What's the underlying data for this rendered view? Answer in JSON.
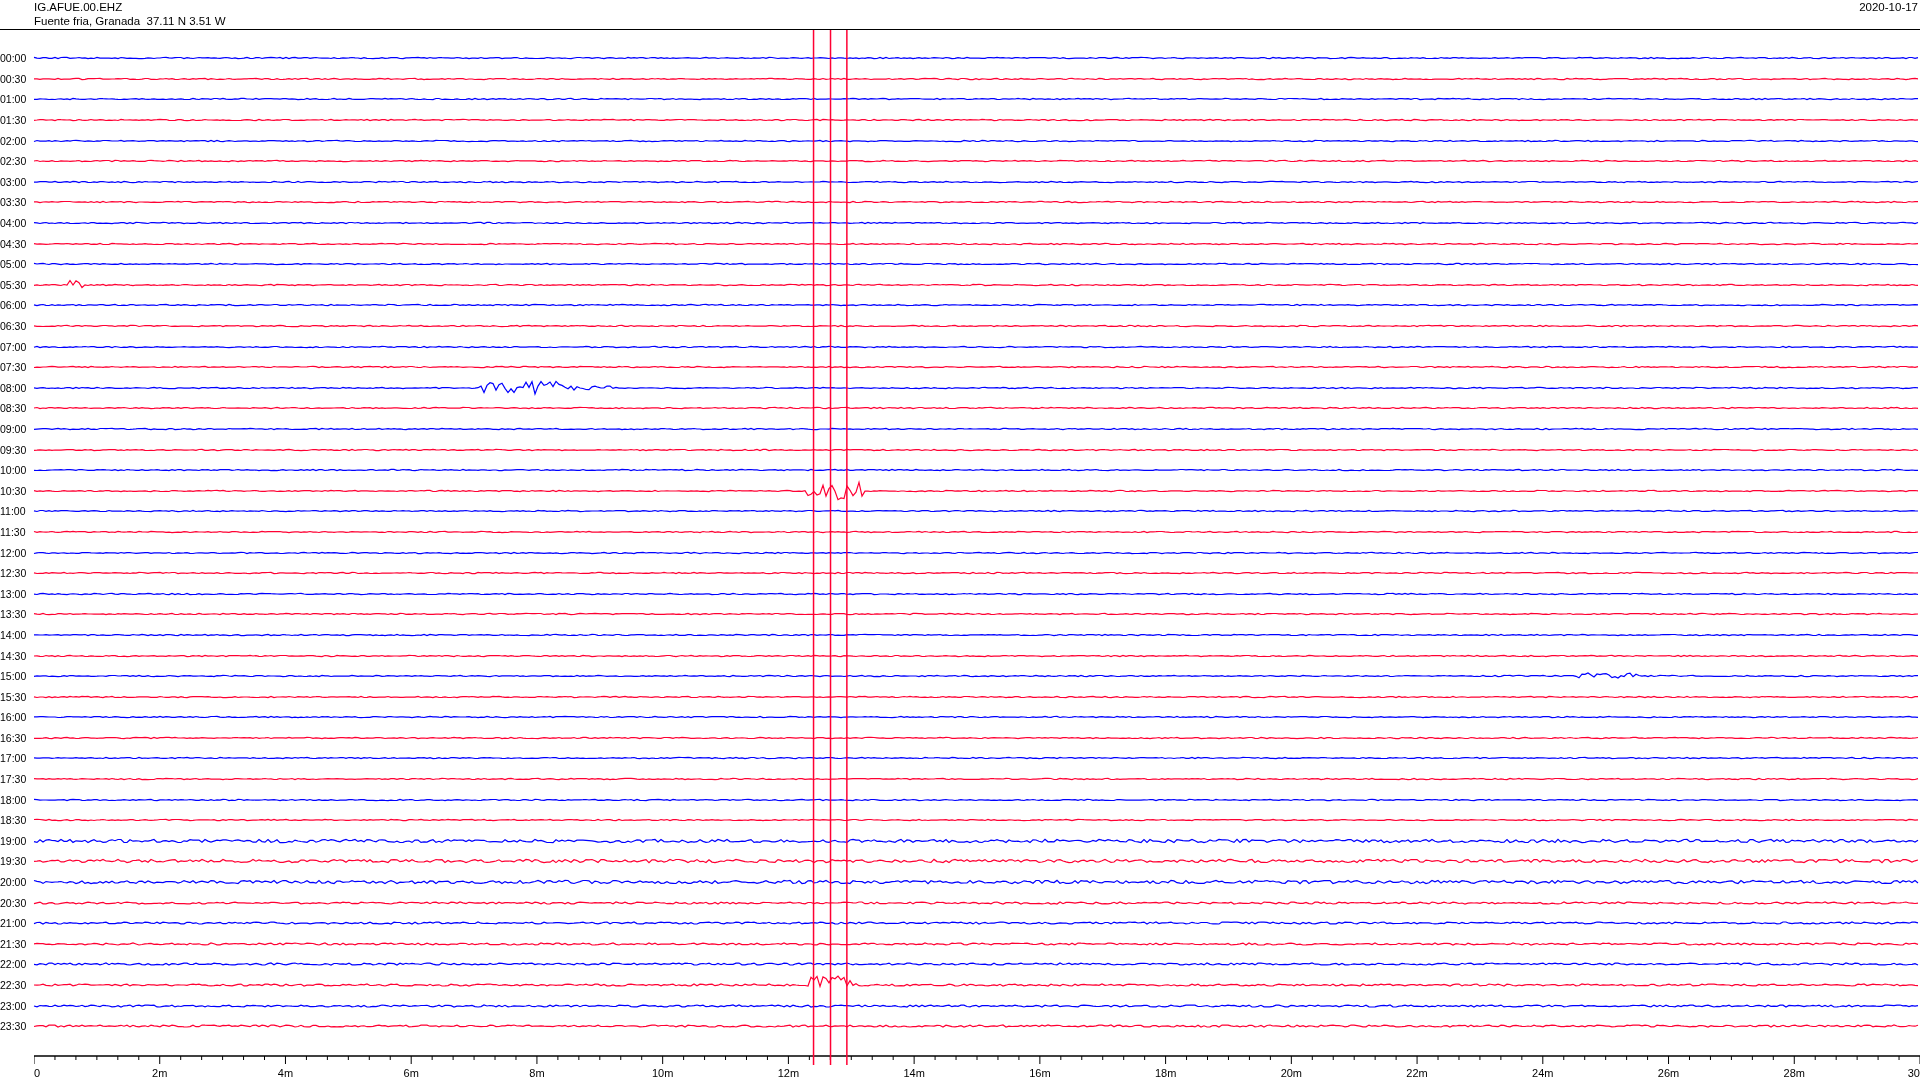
{
  "header": {
    "station": "IG.AFUE.00.EHZ",
    "location": "Fuente fria, Granada  37.11 N 3.51 W",
    "date": "2020-10-17"
  },
  "rows": [
    {
      "time": "00:00"
    },
    {
      "time": "00:30"
    },
    {
      "time": "01:00"
    },
    {
      "time": "01:30"
    },
    {
      "time": "02:00"
    },
    {
      "time": "02:30"
    },
    {
      "time": "03:00"
    },
    {
      "time": "03:30"
    },
    {
      "time": "04:00"
    },
    {
      "time": "04:30"
    },
    {
      "time": "05:00"
    },
    {
      "time": "05:30"
    },
    {
      "time": "06:00"
    },
    {
      "time": "06:30"
    },
    {
      "time": "07:00"
    },
    {
      "time": "07:30"
    },
    {
      "time": "08:00"
    },
    {
      "time": "08:30"
    },
    {
      "time": "09:00"
    },
    {
      "time": "09:30"
    },
    {
      "time": "10:00"
    },
    {
      "time": "10:30"
    },
    {
      "time": "11:00"
    },
    {
      "time": "11:30"
    },
    {
      "time": "12:00"
    },
    {
      "time": "12:30"
    },
    {
      "time": "13:00"
    },
    {
      "time": "13:30"
    },
    {
      "time": "14:00"
    },
    {
      "time": "14:30"
    },
    {
      "time": "15:00"
    },
    {
      "time": "15:30"
    },
    {
      "time": "16:00"
    },
    {
      "time": "16:30"
    },
    {
      "time": "17:00"
    },
    {
      "time": "17:30"
    },
    {
      "time": "18:00"
    },
    {
      "time": "18:30"
    },
    {
      "time": "19:00"
    },
    {
      "time": "19:30"
    },
    {
      "time": "20:00"
    },
    {
      "time": "20:30"
    },
    {
      "time": "21:00"
    },
    {
      "time": "21:30"
    },
    {
      "time": "22:00"
    },
    {
      "time": "22:30"
    },
    {
      "time": "23:00"
    },
    {
      "time": "23:30"
    }
  ],
  "x_axis": {
    "labels": [
      "0",
      "2m",
      "4m",
      "6m",
      "8m",
      "10m",
      "12m",
      "14m",
      "16m",
      "18m",
      "20m",
      "22m",
      "24m",
      "26m",
      "28m",
      "30"
    ]
  }
}
